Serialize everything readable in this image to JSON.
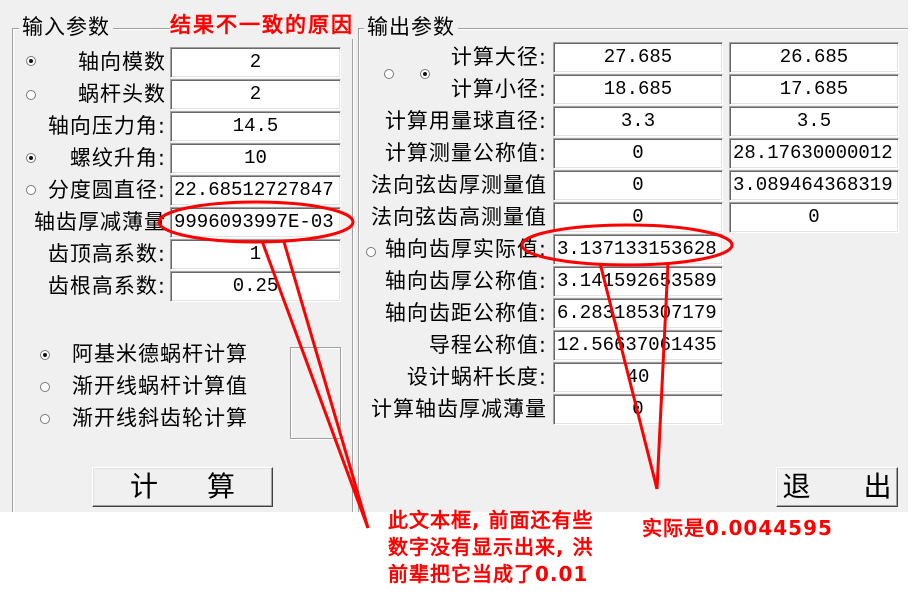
{
  "colors": {
    "panel": "#f0f0f0",
    "annotation": "#ff0000"
  },
  "input_group": {
    "title": "输入参数",
    "rows": [
      {
        "label": "轴向模数",
        "value": "2",
        "radio_checked": true
      },
      {
        "label": "蜗杆头数",
        "value": "2",
        "radio_checked": false
      },
      {
        "label": "轴向压力角:",
        "value": "14.5"
      },
      {
        "label": "螺纹升角:",
        "value": "10",
        "radio_checked": true
      },
      {
        "label": "分度圆直径:",
        "value": "22.68512727847",
        "radio_checked": false
      },
      {
        "label": "轴齿厚减薄量",
        "value": "9996093997E-03"
      },
      {
        "label": "齿顶高系数:",
        "value": "1"
      },
      {
        "label": "齿根高系数:",
        "value": "0.25"
      }
    ],
    "methods": [
      {
        "label": "阿基米德蜗杆计算",
        "checked": true
      },
      {
        "label": "渐开线蜗杆计算值",
        "checked": false
      },
      {
        "label": "渐开线斜齿轮计算",
        "checked": false
      }
    ],
    "calc_button": "计 算"
  },
  "output_group": {
    "title": "输出参数",
    "diameter_radios": [
      {
        "checked": false
      },
      {
        "checked": true
      }
    ],
    "actual_radio": {
      "checked": false
    },
    "rows": [
      {
        "label": "计算大径:",
        "values": [
          "27.685",
          "26.685"
        ]
      },
      {
        "label": "计算小径:",
        "values": [
          "18.685",
          "17.685"
        ]
      },
      {
        "label": "计算用量球直径:",
        "values": [
          "3.3",
          "3.5"
        ]
      },
      {
        "label": "计算测量公称值:",
        "values": [
          "0",
          "28.17630000012"
        ]
      },
      {
        "label": "法向弦齿厚测量值",
        "values": [
          "0",
          "3.089464368319"
        ]
      },
      {
        "label": "法向弦齿高测量值",
        "values": [
          "0",
          "0"
        ]
      },
      {
        "label": "轴向齿厚实际值:",
        "values": [
          "3.137133153628"
        ]
      },
      {
        "label": "轴向齿厚公称值:",
        "values": [
          "3.141592653589"
        ]
      },
      {
        "label": "轴向齿距公称值:",
        "values": [
          "6.283185307179"
        ]
      },
      {
        "label": "导程公称值:",
        "values": [
          "12.56637061435"
        ]
      },
      {
        "label": "设计蜗杆长度:",
        "values": [
          "40"
        ]
      },
      {
        "label": "计算轴齿厚减薄量",
        "values": [
          "0"
        ]
      }
    ],
    "exit_button": "退 出"
  },
  "annotations": {
    "title_note": "结果不一致的原因",
    "textbox_note": [
      "此文本框, 前面还有些",
      "数字没有显示出来, 洪",
      "前辈把它当成了0.01"
    ],
    "actual_note": "实际是0.0044595"
  }
}
